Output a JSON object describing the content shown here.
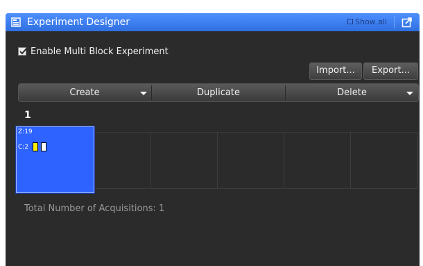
{
  "window": {
    "title": "Experiment Designer",
    "show_all_label": "Show all",
    "colors": {
      "titlebar": "#3a7cf0",
      "panel": "#2b2b2b",
      "accent": "#2e63ff"
    }
  },
  "multi_block": {
    "label": "Enable Multi Block Experiment",
    "checked": true
  },
  "io_buttons": {
    "import_label": "Import...",
    "export_label": "Export..."
  },
  "actions": {
    "create_label": "Create",
    "duplicate_label": "Duplicate",
    "delete_label": "Delete"
  },
  "blocks": {
    "current_number": "1",
    "items": [
      {
        "z_label": "Z:19",
        "c_label": "C:2",
        "channel_colors": [
          "#ffee00",
          "#ffffff"
        ]
      }
    ]
  },
  "summary": {
    "total_acquisitions": "Total Number of Acquisitions: 1"
  }
}
